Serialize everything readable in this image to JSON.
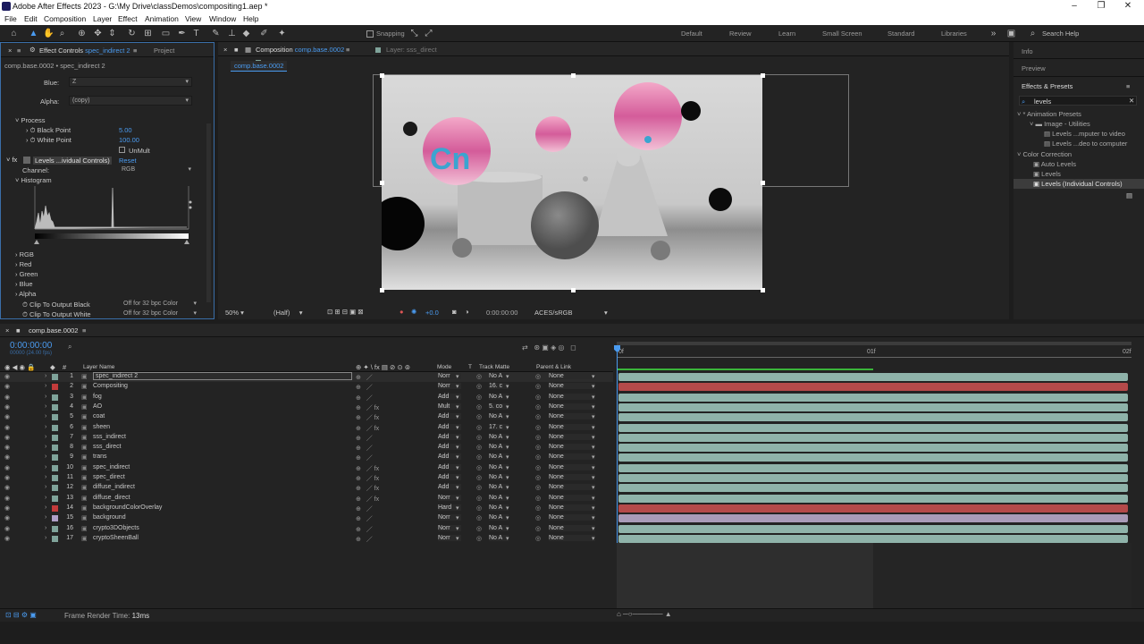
{
  "app": {
    "title": "Adobe After Effects 2023 - G:\\My Drive\\classDemos\\compositing1.aep *"
  },
  "menu": [
    "File",
    "Edit",
    "Composition",
    "Layer",
    "Effect",
    "Animation",
    "View",
    "Window",
    "Help"
  ],
  "toolbar": {
    "snapping": "Snapping",
    "workspaces": [
      "Default",
      "Review",
      "Learn",
      "Small Screen",
      "Standard",
      "Libraries"
    ],
    "search": "Search Help"
  },
  "effect_controls": {
    "tab": "Effect Controls",
    "tab_layer": "spec_indirect 2",
    "tab_project": "Project",
    "header": "comp.base.0002 • spec_indirect 2",
    "blue_label": "Blue:",
    "blue_value": "Z",
    "alpha_label": "Alpha:",
    "alpha_value": "(copy)",
    "process": "Process",
    "black_point": "Black Point",
    "black_point_value": "5.00",
    "white_point": "White Point",
    "white_point_value": "100.00",
    "unmult": "UnMult",
    "fx_name": "Levels ...ividual Controls)",
    "reset": "Reset",
    "channel_label": "Channel:",
    "channel_value": "RGB",
    "histogram": "Histogram",
    "groups": [
      "RGB",
      "Red",
      "Green",
      "Blue",
      "Alpha"
    ],
    "clip_black": "Clip To Output Black",
    "clip_black_value": "Off for 32 bpc Color",
    "clip_white": "Clip To Output White",
    "clip_white_value": "Off for 32 bpc Color"
  },
  "composition": {
    "tab": "Composition",
    "tab_name": "comp.base.0002",
    "layer_tab": "Layer: sss_direct",
    "subtab": "comp.base.0002",
    "footer": {
      "zoom": "50%",
      "resolution": "(Half)",
      "exposure": "+0.0",
      "time": "0:00:00:00",
      "colorspace": "ACES/sRGB"
    }
  },
  "right_panel": {
    "info": "Info",
    "preview": "Preview",
    "effects_presets": "Effects & Presets",
    "search_value": "levels",
    "tree": [
      {
        "label": "* Animation Presets",
        "level": 0
      },
      {
        "label": "Image - Utilities",
        "level": 1
      },
      {
        "label": "Levels ...mputer to video",
        "level": 2
      },
      {
        "label": "Levels ...deo to computer",
        "level": 2
      },
      {
        "label": "Color Correction",
        "level": 0
      },
      {
        "label": "Auto Levels",
        "level": 1
      },
      {
        "label": "Levels",
        "level": 1
      },
      {
        "label": "Levels (Individual Controls)",
        "level": 1
      }
    ]
  },
  "timeline": {
    "tab": "comp.base.0002",
    "timecode": "0:00:00:00",
    "fps": "00000 (24.00 fps)",
    "headers": {
      "layer_name": "Layer Name",
      "mode": "Mode",
      "t": "T",
      "track_matte": "Track Matte",
      "parent": "Parent & Link"
    },
    "ruler": [
      "0f",
      "01f",
      "02f"
    ],
    "layers": [
      {
        "num": "1",
        "name": "spec_indirect 2",
        "mode": "Norr",
        "matte": "No A",
        "parent": "None",
        "color": "#7fa39a",
        "bar": "#8fb3aa"
      },
      {
        "num": "2",
        "name": "Compositing",
        "mode": "Norr",
        "matte": "16. c",
        "parent": "None",
        "color": "#c23b3b",
        "bar": "#b44a4a"
      },
      {
        "num": "3",
        "name": "fog",
        "mode": "Add",
        "matte": "No A",
        "parent": "None",
        "color": "#7fa39a",
        "bar": "#8fb3aa"
      },
      {
        "num": "4",
        "name": "AO",
        "mode": "Mult",
        "matte": "5. co",
        "parent": "None",
        "color": "#7fa39a",
        "bar": "#8fb3aa"
      },
      {
        "num": "5",
        "name": "coat",
        "mode": "Add",
        "matte": "No A",
        "parent": "None",
        "color": "#7fa39a",
        "bar": "#8fb3aa"
      },
      {
        "num": "6",
        "name": "sheen",
        "mode": "Add",
        "matte": "17. c",
        "parent": "None",
        "color": "#7fa39a",
        "bar": "#8fb3aa"
      },
      {
        "num": "7",
        "name": "sss_indirect",
        "mode": "Add",
        "matte": "No A",
        "parent": "None",
        "color": "#7fa39a",
        "bar": "#8fb3aa"
      },
      {
        "num": "8",
        "name": "sss_direct",
        "mode": "Add",
        "matte": "No A",
        "parent": "None",
        "color": "#7fa39a",
        "bar": "#8fb3aa"
      },
      {
        "num": "9",
        "name": "trans",
        "mode": "Add",
        "matte": "No A",
        "parent": "None",
        "color": "#7fa39a",
        "bar": "#8fb3aa"
      },
      {
        "num": "10",
        "name": "spec_indirect",
        "mode": "Add",
        "matte": "No A",
        "parent": "None",
        "color": "#7fa39a",
        "bar": "#8fb3aa"
      },
      {
        "num": "11",
        "name": "spec_direct",
        "mode": "Add",
        "matte": "No A",
        "parent": "None",
        "color": "#7fa39a",
        "bar": "#8fb3aa"
      },
      {
        "num": "12",
        "name": "diffuse_indirect",
        "mode": "Add",
        "matte": "No A",
        "parent": "None",
        "color": "#7fa39a",
        "bar": "#8fb3aa"
      },
      {
        "num": "13",
        "name": "diffuse_direct",
        "mode": "Norr",
        "matte": "No A",
        "parent": "None",
        "color": "#7fa39a",
        "bar": "#8fb3aa"
      },
      {
        "num": "14",
        "name": "backgroundColorOverlay",
        "mode": "Hard",
        "matte": "No A",
        "parent": "None",
        "color": "#c23b3b",
        "bar": "#b44a4a"
      },
      {
        "num": "15",
        "name": "background",
        "mode": "Norr",
        "matte": "No A",
        "parent": "None",
        "color": "#b0a0c8",
        "bar": "#a99bb8"
      },
      {
        "num": "16",
        "name": "crypto3DObjects",
        "mode": "Norr",
        "matte": "No A",
        "parent": "None",
        "color": "#7fa39a",
        "bar": "#8fb3aa"
      },
      {
        "num": "17",
        "name": "cryptoSheenBall",
        "mode": "Norr",
        "matte": "No A",
        "parent": "None",
        "color": "#7fa39a",
        "bar": "#8fb3aa"
      }
    ],
    "status": "Frame Render Time:",
    "render_time": "13ms"
  }
}
